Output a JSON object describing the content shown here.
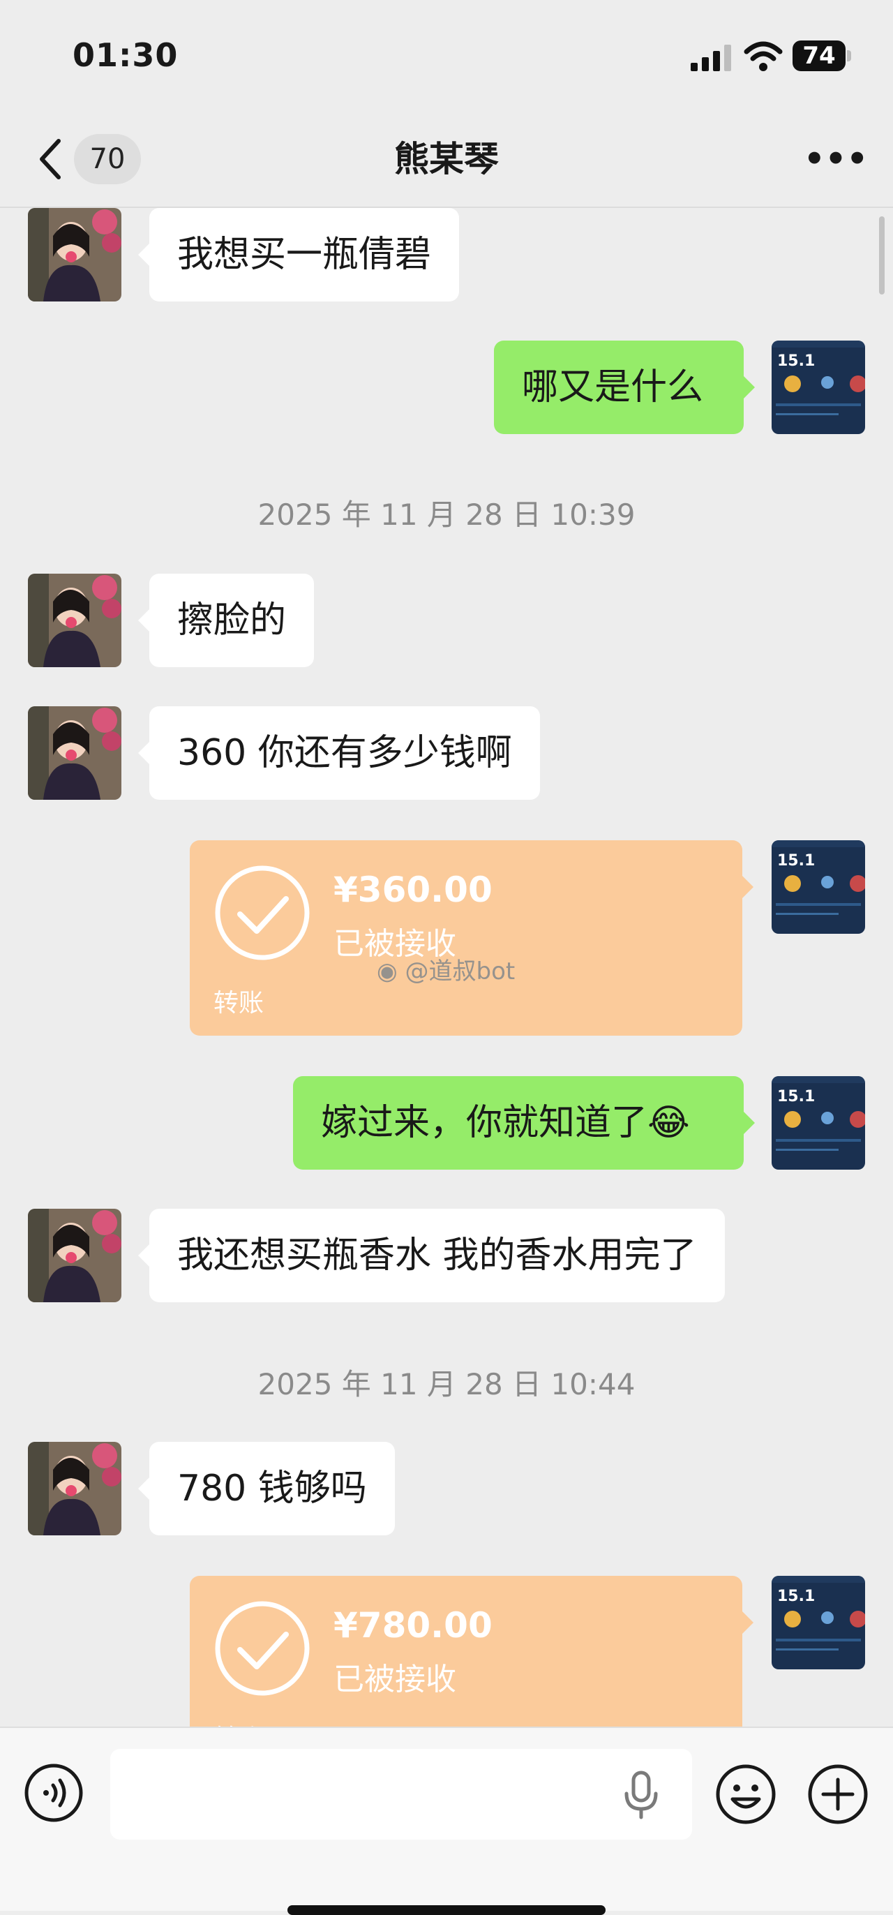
{
  "status_bar": {
    "time": "01:30",
    "battery": "74"
  },
  "nav": {
    "unread_count": "70",
    "title": "熊某琴",
    "more_icon": "ellipsis-icon"
  },
  "messages": [
    {
      "side": "in",
      "text": "我想买一瓶倩碧"
    },
    {
      "side": "out",
      "text": "哪又是什么"
    },
    {
      "type": "timestamp",
      "text": "2025 年 11 月 28 日 10:39"
    },
    {
      "side": "in",
      "text": "擦脸的"
    },
    {
      "side": "in",
      "text": "360 你还有多少钱啊"
    },
    {
      "side": "out",
      "type": "transfer",
      "amount": "¥360.00",
      "status": "已被接收",
      "label": "转账"
    },
    {
      "side": "out",
      "text": "嫁过来，你就知道了😂"
    },
    {
      "side": "in",
      "text": "我还想买瓶香水 我的香水用完了"
    },
    {
      "type": "timestamp",
      "text": "2025 年 11 月 28 日 10:44"
    },
    {
      "side": "in",
      "text": "780 钱够吗"
    },
    {
      "side": "out",
      "type": "transfer",
      "amount": "¥780.00",
      "status": "已被接收",
      "label": "转账"
    }
  ],
  "watermark": "@道叔bot",
  "input_bar": {
    "placeholder": ""
  },
  "colors": {
    "background": "#ededed",
    "outgoing_bubble": "#95ec69",
    "incoming_bubble": "#ffffff",
    "transfer_card": "#fbcb9b"
  }
}
